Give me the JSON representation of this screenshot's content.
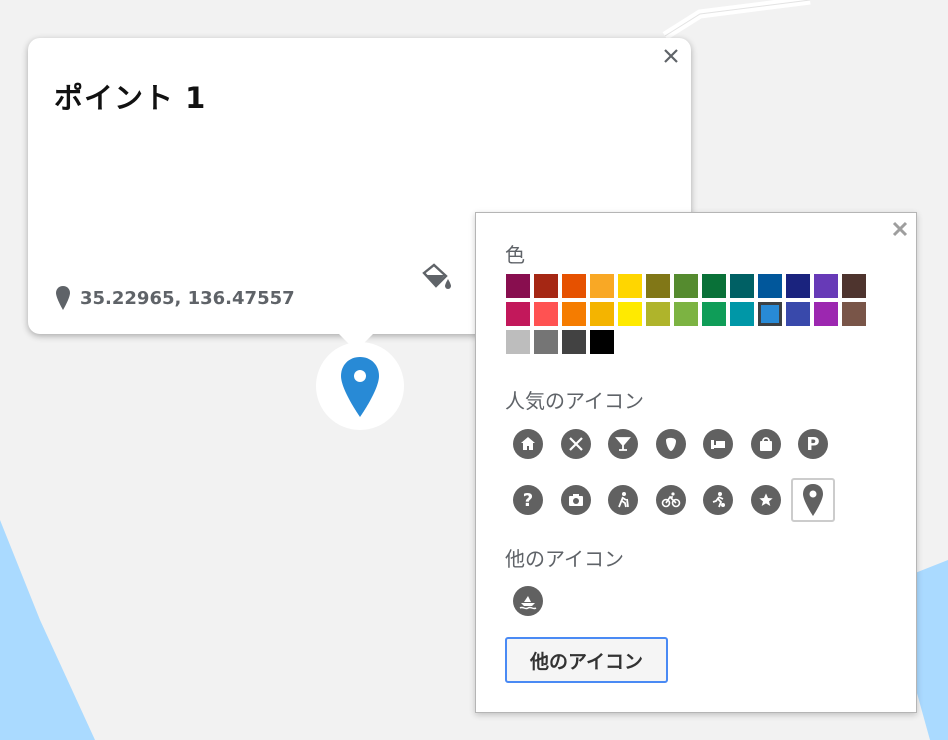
{
  "info_window": {
    "title": "ポイント 1",
    "coordinates": "35.22965, 136.47557",
    "close_icon": "close-icon",
    "style_icon": "paint-bucket-icon"
  },
  "marker": {
    "icon": "location-pin-icon",
    "color": "#288ad6"
  },
  "style_picker": {
    "color_label": "色",
    "popular_label": "人気のアイコン",
    "other_label": "他のアイコン",
    "more_button": "他のアイコン",
    "selected_color": "#288ad6",
    "colors": [
      "#880e4f",
      "#a52714",
      "#e65100",
      "#f9a825",
      "#ffd600",
      "#817717",
      "#558b2f",
      "#097138",
      "#006064",
      "#01579b",
      "#1a237e",
      "#673ab7",
      "#4e342e",
      "#c2185b",
      "#ff5252",
      "#f57c00",
      "#f4b400",
      "#ffea00",
      "#afb42b",
      "#7cb342",
      "#0f9d58",
      "#0097a7",
      "#288ad6",
      "#3949ab",
      "#9c27b0",
      "#795548",
      "#bdbdbd",
      "#757575",
      "#424242",
      "#000000"
    ],
    "popular_icons": [
      "home-icon",
      "restaurant-icon",
      "bar-icon",
      "cafe-icon",
      "hotel-icon",
      "shopping-icon",
      "parking-icon",
      "help-icon",
      "camera-icon",
      "hiking-icon",
      "cycling-icon",
      "running-icon",
      "star-icon",
      "location-pin-icon"
    ],
    "selected_icon": "location-pin-icon",
    "other_icons": [
      "boat-icon"
    ]
  }
}
